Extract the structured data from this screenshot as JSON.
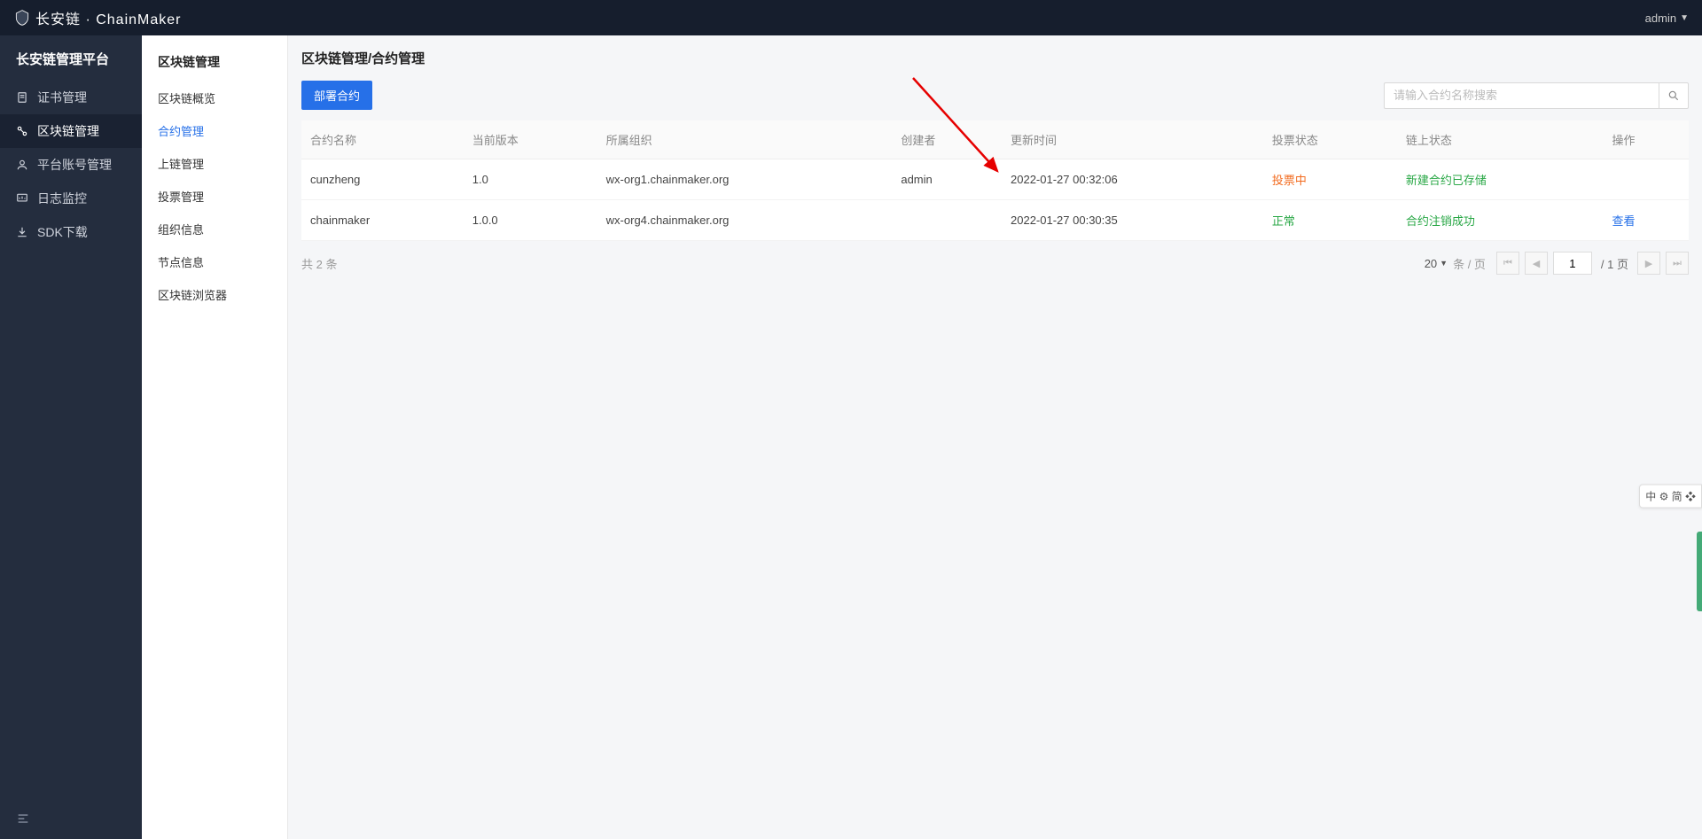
{
  "header": {
    "brand": "长安链 · ChainMaker",
    "user_label": "admin"
  },
  "sidebar_primary": {
    "title": "长安链管理平台",
    "items": [
      {
        "label": "证书管理",
        "icon": "doc"
      },
      {
        "label": "区块链管理",
        "icon": "chain",
        "active": true
      },
      {
        "label": "平台账号管理",
        "icon": "user"
      },
      {
        "label": "日志监控",
        "icon": "monitor"
      },
      {
        "label": "SDK下载",
        "icon": "download"
      }
    ]
  },
  "sidebar_secondary": {
    "title": "区块链管理",
    "items": [
      {
        "label": "区块链概览"
      },
      {
        "label": "合约管理",
        "active": true
      },
      {
        "label": "上链管理"
      },
      {
        "label": "投票管理"
      },
      {
        "label": "组织信息"
      },
      {
        "label": "节点信息"
      },
      {
        "label": "区块链浏览器"
      }
    ]
  },
  "main": {
    "breadcrumb": "区块链管理/合约管理",
    "deploy_button": "部署合约",
    "search_placeholder": "请输入合约名称搜索",
    "columns": {
      "name": "合约名称",
      "version": "当前版本",
      "org": "所属组织",
      "creator": "创建者",
      "updated": "更新时间",
      "vote_status": "投票状态",
      "chain_status": "链上状态",
      "action": "操作"
    },
    "rows": [
      {
        "name": "cunzheng",
        "version": "1.0",
        "org": "wx-org1.chainmaker.org",
        "creator": "admin",
        "updated": "2022-01-27 00:32:06",
        "vote_status": "投票中",
        "vote_class": "status-orange",
        "chain_status": "新建合约已存储",
        "chain_class": "status-green",
        "action": ""
      },
      {
        "name": "chainmaker",
        "version": "1.0.0",
        "org": "wx-org4.chainmaker.org",
        "creator": "",
        "updated": "2022-01-27 00:30:35",
        "vote_status": "正常",
        "vote_class": "status-green",
        "chain_status": "合约注销成功",
        "chain_class": "status-green",
        "action": "查看"
      }
    ],
    "footer": {
      "total_prefix": "共",
      "total_count": "2",
      "total_suffix": "条",
      "page_size": "20",
      "page_size_label": "条 / 页",
      "page_current": "1",
      "page_total_label": "/ 1 页"
    }
  },
  "ime_widget": "中 ⚙ 简 ❖"
}
